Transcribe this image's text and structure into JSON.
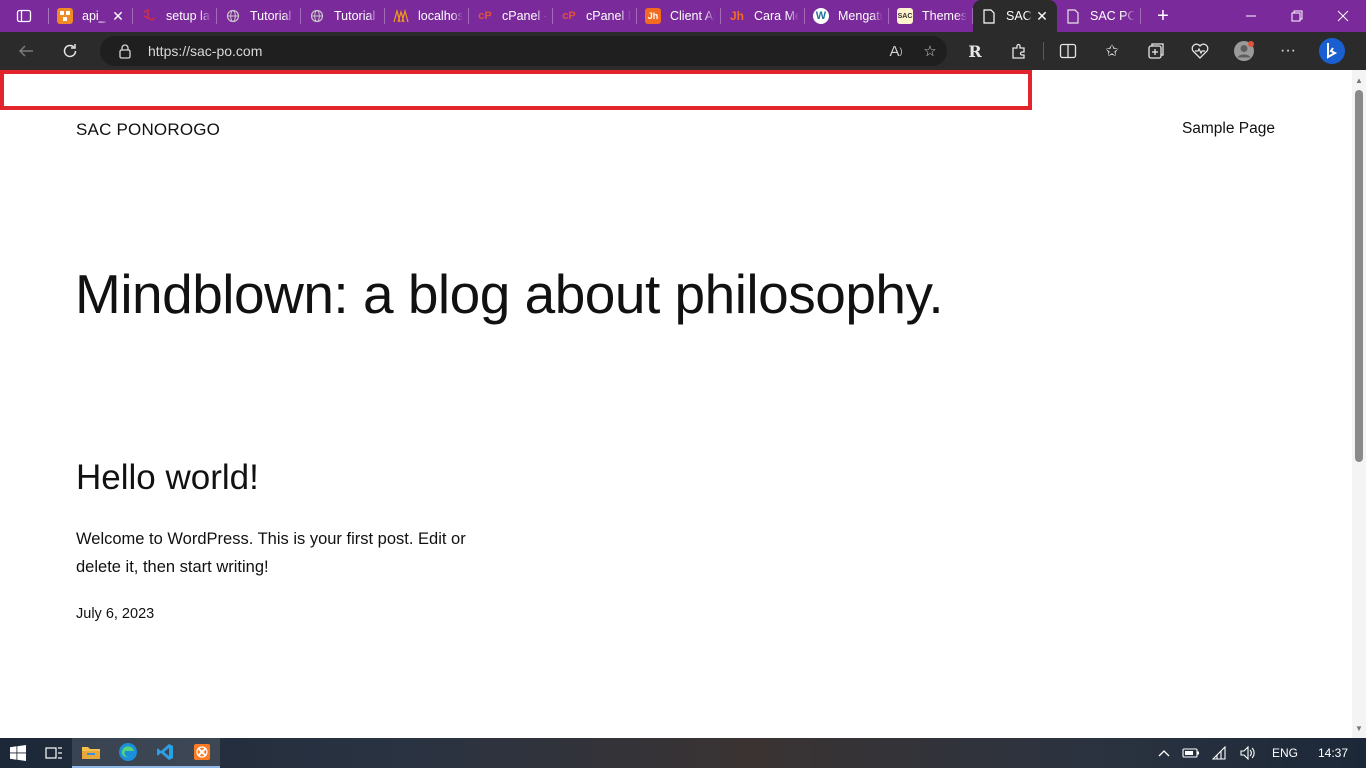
{
  "browser": {
    "tabs": [
      {
        "title": "api_",
        "icon": "orange-squares-icon",
        "icon_color": "#f08a24",
        "closable": true,
        "active": false
      },
      {
        "title": "setup lar",
        "icon": "laravel-icon",
        "icon_color": "#d9303e",
        "active": false
      },
      {
        "title": "Tutorial I",
        "icon": "globe-icon",
        "icon_color": "#c8c8c8",
        "active": false
      },
      {
        "title": "Tutorial I",
        "icon": "globe-icon",
        "icon_color": "#c8c8c8",
        "active": false
      },
      {
        "title": "localhost",
        "icon": "phpmyadmin-icon",
        "icon_color": "#f39c12",
        "active": false
      },
      {
        "title": "cPanel -",
        "icon": "cpanel-icon",
        "icon_color": "#e0533b",
        "active": false
      },
      {
        "title": "cPanel Fi",
        "icon": "cpanel-icon",
        "icon_color": "#e0533b",
        "active": false
      },
      {
        "title": "Client Ar",
        "icon": "jh-icon",
        "icon_color": "#f26b21",
        "active": false
      },
      {
        "title": "Cara Mer",
        "icon": "jh-icon",
        "icon_color": "#f26b21",
        "active": false
      },
      {
        "title": "Mengatu",
        "icon": "wordpress-icon",
        "icon_color": "#21759b",
        "active": false
      },
      {
        "title": "Themes",
        "icon": "sac-logo-icon",
        "icon_color": "#e8b400",
        "active": false
      },
      {
        "title": "SAC",
        "icon": "page-icon",
        "icon_color": "#ffffff",
        "closable": true,
        "active": true
      },
      {
        "title": "SAC PON",
        "icon": "page-icon",
        "icon_color": "#ffffff",
        "active": false
      }
    ],
    "new_tab_label": "+",
    "url": "https://sac-po.com",
    "accent_color": "#7b2a9b"
  },
  "page": {
    "site_title": "SAC PONOROGO",
    "nav_link": "Sample Page",
    "hero": "Mindblown: a blog about philosophy.",
    "post": {
      "title": "Hello world!",
      "excerpt": "Welcome to WordPress. This is your first post. Edit or delete it, then start writing!",
      "date": "July 6, 2023"
    },
    "highlight_color": "#e2242b"
  },
  "taskbar": {
    "apps": [
      "windows-start-icon",
      "task-view-icon",
      "file-explorer-icon",
      "edge-icon",
      "vscode-icon",
      "xampp-icon"
    ],
    "language": "ENG",
    "time": "14:37"
  }
}
